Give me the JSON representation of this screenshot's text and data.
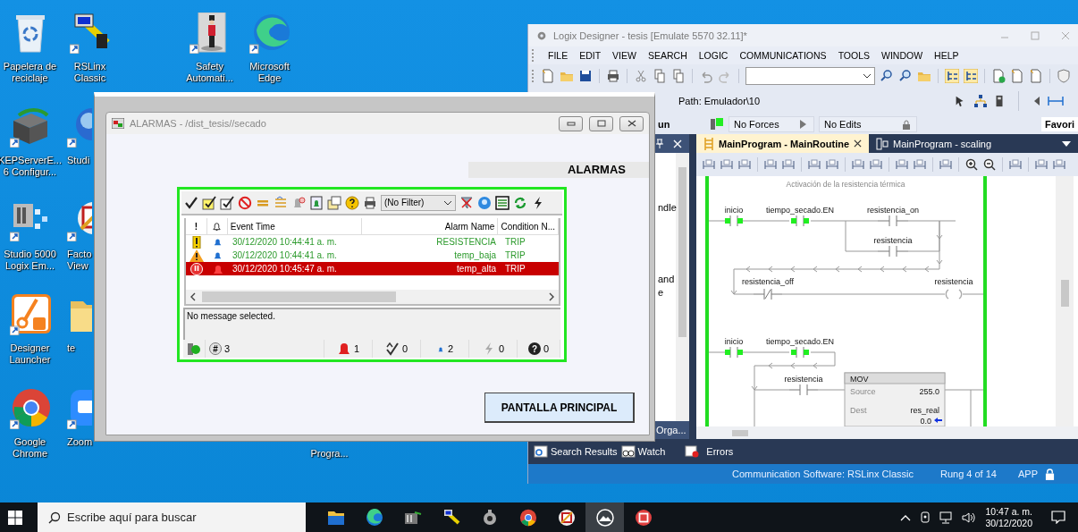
{
  "desktop_icons": [
    {
      "kind": "recycle-bin",
      "lines": [
        "Papelera de",
        "reciclaje"
      ]
    },
    {
      "kind": "network-pc",
      "lines": [
        "RSLinx",
        "Classic"
      ]
    },
    {
      "kind": "guard",
      "lines": [
        "Safety",
        "Automati..."
      ]
    },
    {
      "kind": "swirl",
      "lines": [
        "Microsoft",
        "Edge"
      ]
    },
    {
      "kind": "server",
      "lines": [
        "KEPServerE...",
        "6 Configur..."
      ]
    },
    {
      "kind": "globe",
      "lines": [
        "Studi"
      ]
    },
    {
      "kind": "tiles",
      "lines": [
        "Studio 5000",
        "Logix Em..."
      ]
    },
    {
      "kind": "pencil-frame",
      "lines": [
        "Facto",
        "View"
      ]
    },
    {
      "kind": "wrench",
      "lines": [
        "Designer",
        "Launcher"
      ]
    },
    {
      "kind": "folder",
      "lines": [
        "te"
      ]
    },
    {
      "kind": "ring",
      "lines": [
        "Google",
        "Chrome"
      ]
    },
    {
      "kind": "camera",
      "lines": [
        "Zoom"
      ]
    },
    {
      "kind": "covered",
      "lines": [
        "Progra..."
      ]
    }
  ],
  "logix": {
    "title": "Logix Designer - tesis [Emulate 5570 32.11]*",
    "menu": [
      "FILE",
      "EDIT",
      "VIEW",
      "SEARCH",
      "LOGIC",
      "COMMUNICATIONS",
      "TOOLS",
      "WINDOW",
      "HELP"
    ],
    "path": "Path: Emulador\\10",
    "mode": "un",
    "forces": "No Forces",
    "edits": "No Edits",
    "favorites": "Favori",
    "pane_texts": [
      "ndle",
      "and",
      "e"
    ],
    "pane_tab": "Orga...",
    "tabs": [
      {
        "kind": "ladder",
        "label": "MainProgram - MainRoutine",
        "selected": true
      },
      {
        "kind": "function-block",
        "label": "MainProgram - scaling",
        "selected": false
      }
    ],
    "ladder": {
      "comment": "Activación de la resistencia térmica",
      "rung_1": {
        "contacts": [
          {
            "tag": "inicio",
            "energized": true
          },
          {
            "tag": "tiempo_secado.EN",
            "energized": true
          }
        ],
        "branch": [
          {
            "tag": "resistencia_on",
            "energized": false
          },
          {
            "tag": "resistencia",
            "energized": false
          }
        ],
        "nc_contact": {
          "tag": "resistencia_off",
          "energized": false
        },
        "coil": {
          "tag": "resistencia",
          "energized": false
        }
      },
      "rung_2": {
        "contacts": [
          {
            "tag": "inicio",
            "energized": true
          },
          {
            "tag": "tiempo_secado.EN",
            "energized": true
          }
        ],
        "branch_contact": {
          "tag": "resistencia",
          "energized": false
        },
        "mov": {
          "title": "MOV",
          "source_label": "Source",
          "source_value": "255.0",
          "dest_label": "Dest",
          "dest_tag": "res_real",
          "dest_value": "0.0"
        }
      }
    },
    "bottom_tabs": [
      {
        "kind": "search",
        "label": "Search Results"
      },
      {
        "kind": "watch",
        "label": "Watch"
      },
      {
        "kind": "errors",
        "label": "Errors"
      }
    ],
    "status": {
      "communication": "Communication Software: RSLinx Classic",
      "rung": "Rung 4 of 14",
      "mode": "APP"
    }
  },
  "alarm_window": {
    "title": "ALARMAS - /dist_tesis//secado",
    "banner": "ALARMAS",
    "filter": "(No Filter)",
    "columns": [
      {
        "kind": "text",
        "label": "!"
      },
      {
        "kind": "bell"
      },
      {
        "kind": "text",
        "label": "Event Time"
      },
      {
        "kind": "text",
        "label": "Alarm Name"
      },
      {
        "kind": "text",
        "label": "Condition N..."
      }
    ],
    "rows": [
      {
        "kind": "medium",
        "in_alarm": false,
        "event_time": "30/12/2020 10:44:41 a. m.",
        "alarm_name": "RESISTENCIA",
        "condition": "TRIP"
      },
      {
        "kind": "high",
        "in_alarm": false,
        "event_time": "30/12/2020 10:44:41 a. m.",
        "alarm_name": "temp_baja",
        "condition": "TRIP"
      },
      {
        "kind": "urgent",
        "in_alarm": true,
        "event_time": "30/12/2020 10:45:47 a. m.",
        "alarm_name": "temp_alta",
        "condition": "TRIP"
      }
    ],
    "message": "No message selected.",
    "counts": [
      {
        "kind": "total",
        "symbol": "#",
        "value": "3"
      },
      {
        "kind": "alarm",
        "value": "1"
      },
      {
        "kind": "acked",
        "value": "0"
      },
      {
        "kind": "normal",
        "value": "2"
      },
      {
        "kind": "fault",
        "value": "0"
      },
      {
        "kind": "unknown",
        "symbol": "?",
        "value": "0"
      }
    ],
    "button": "PANTALLA PRINCIPAL"
  },
  "taskbar": {
    "search_placeholder": "Escribe aquí para buscar",
    "apps": [
      {
        "kind": "folder",
        "selected": false
      },
      {
        "kind": "swirl",
        "selected": false
      },
      {
        "kind": "server",
        "selected": false
      },
      {
        "kind": "network-pc",
        "selected": false
      },
      {
        "kind": "gear",
        "selected": false
      },
      {
        "kind": "ring",
        "selected": false
      },
      {
        "kind": "pencil-frame",
        "selected": false
      },
      {
        "kind": "mountain",
        "selected": true
      },
      {
        "kind": "stop",
        "selected": false
      }
    ],
    "time": "10:47 a. m.",
    "date": "30/12/2020"
  }
}
